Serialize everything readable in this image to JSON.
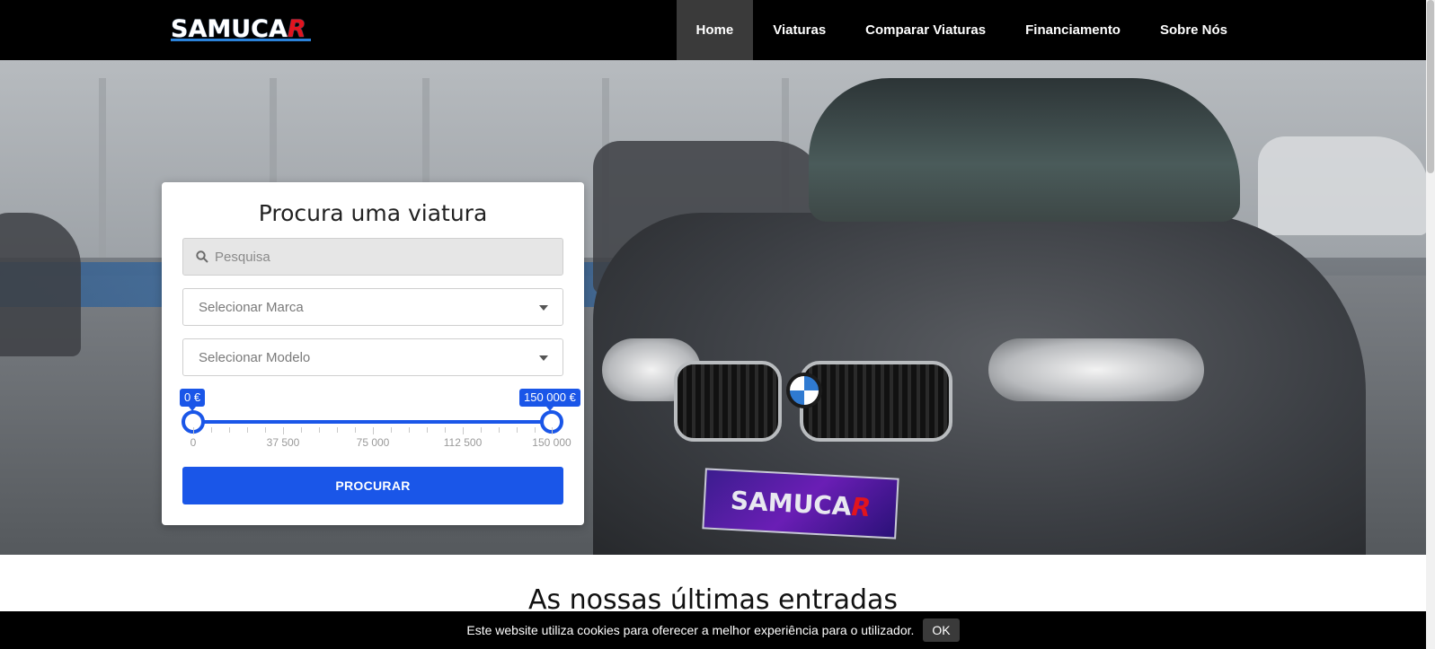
{
  "navbar": {
    "logo_main": "SAMUCA",
    "logo_r": "R",
    "items": [
      {
        "label": "Home",
        "active": true
      },
      {
        "label": "Viaturas",
        "active": false
      },
      {
        "label": "Comparar Viaturas",
        "active": false
      },
      {
        "label": "Financiamento",
        "active": false
      },
      {
        "label": "Sobre Nós",
        "active": false
      }
    ]
  },
  "hero": {
    "plate_main": "SAMUCA",
    "plate_r": "R"
  },
  "search_card": {
    "title": "Procura uma viatura",
    "search_placeholder": "Pesquisa",
    "brand_select": "Selecionar Marca",
    "model_select": "Selecionar Modelo",
    "price_slider": {
      "min_label": "0 €",
      "max_label": "150 000 €",
      "min_value": 0,
      "max_value": 150000,
      "ticks": [
        "0",
        "37 500",
        "75 000",
        "112 500",
        "150 000"
      ]
    },
    "submit_label": "PROCURAR"
  },
  "latest": {
    "title": "As nossas últimas entradas"
  },
  "cookie": {
    "text": "Este website utiliza cookies para oferecer a melhor experiência para o utilizador.",
    "ok_label": "OK"
  },
  "colors": {
    "primary": "#1a56e8",
    "navbar_bg": "#000000",
    "nav_active_bg": "#3a3a3a"
  }
}
